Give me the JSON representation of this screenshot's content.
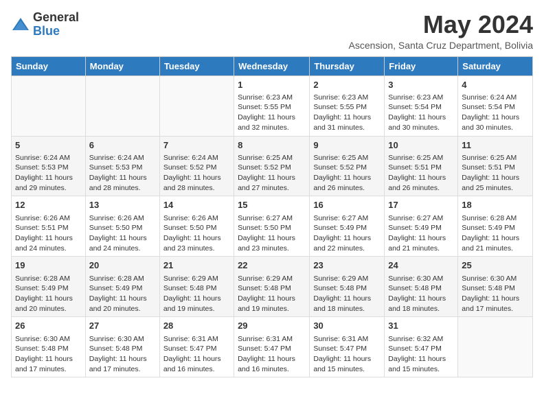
{
  "logo": {
    "general": "General",
    "blue": "Blue"
  },
  "title": "May 2024",
  "subtitle": "Ascension, Santa Cruz Department, Bolivia",
  "days_header": [
    "Sunday",
    "Monday",
    "Tuesday",
    "Wednesday",
    "Thursday",
    "Friday",
    "Saturday"
  ],
  "weeks": [
    [
      {
        "day": "",
        "text": ""
      },
      {
        "day": "",
        "text": ""
      },
      {
        "day": "",
        "text": ""
      },
      {
        "day": "1",
        "text": "Sunrise: 6:23 AM\nSunset: 5:55 PM\nDaylight: 11 hours and 32 minutes."
      },
      {
        "day": "2",
        "text": "Sunrise: 6:23 AM\nSunset: 5:55 PM\nDaylight: 11 hours and 31 minutes."
      },
      {
        "day": "3",
        "text": "Sunrise: 6:23 AM\nSunset: 5:54 PM\nDaylight: 11 hours and 30 minutes."
      },
      {
        "day": "4",
        "text": "Sunrise: 6:24 AM\nSunset: 5:54 PM\nDaylight: 11 hours and 30 minutes."
      }
    ],
    [
      {
        "day": "5",
        "text": "Sunrise: 6:24 AM\nSunset: 5:53 PM\nDaylight: 11 hours and 29 minutes."
      },
      {
        "day": "6",
        "text": "Sunrise: 6:24 AM\nSunset: 5:53 PM\nDaylight: 11 hours and 28 minutes."
      },
      {
        "day": "7",
        "text": "Sunrise: 6:24 AM\nSunset: 5:52 PM\nDaylight: 11 hours and 28 minutes."
      },
      {
        "day": "8",
        "text": "Sunrise: 6:25 AM\nSunset: 5:52 PM\nDaylight: 11 hours and 27 minutes."
      },
      {
        "day": "9",
        "text": "Sunrise: 6:25 AM\nSunset: 5:52 PM\nDaylight: 11 hours and 26 minutes."
      },
      {
        "day": "10",
        "text": "Sunrise: 6:25 AM\nSunset: 5:51 PM\nDaylight: 11 hours and 26 minutes."
      },
      {
        "day": "11",
        "text": "Sunrise: 6:25 AM\nSunset: 5:51 PM\nDaylight: 11 hours and 25 minutes."
      }
    ],
    [
      {
        "day": "12",
        "text": "Sunrise: 6:26 AM\nSunset: 5:51 PM\nDaylight: 11 hours and 24 minutes."
      },
      {
        "day": "13",
        "text": "Sunrise: 6:26 AM\nSunset: 5:50 PM\nDaylight: 11 hours and 24 minutes."
      },
      {
        "day": "14",
        "text": "Sunrise: 6:26 AM\nSunset: 5:50 PM\nDaylight: 11 hours and 23 minutes."
      },
      {
        "day": "15",
        "text": "Sunrise: 6:27 AM\nSunset: 5:50 PM\nDaylight: 11 hours and 23 minutes."
      },
      {
        "day": "16",
        "text": "Sunrise: 6:27 AM\nSunset: 5:49 PM\nDaylight: 11 hours and 22 minutes."
      },
      {
        "day": "17",
        "text": "Sunrise: 6:27 AM\nSunset: 5:49 PM\nDaylight: 11 hours and 21 minutes."
      },
      {
        "day": "18",
        "text": "Sunrise: 6:28 AM\nSunset: 5:49 PM\nDaylight: 11 hours and 21 minutes."
      }
    ],
    [
      {
        "day": "19",
        "text": "Sunrise: 6:28 AM\nSunset: 5:49 PM\nDaylight: 11 hours and 20 minutes."
      },
      {
        "day": "20",
        "text": "Sunrise: 6:28 AM\nSunset: 5:49 PM\nDaylight: 11 hours and 20 minutes."
      },
      {
        "day": "21",
        "text": "Sunrise: 6:29 AM\nSunset: 5:48 PM\nDaylight: 11 hours and 19 minutes."
      },
      {
        "day": "22",
        "text": "Sunrise: 6:29 AM\nSunset: 5:48 PM\nDaylight: 11 hours and 19 minutes."
      },
      {
        "day": "23",
        "text": "Sunrise: 6:29 AM\nSunset: 5:48 PM\nDaylight: 11 hours and 18 minutes."
      },
      {
        "day": "24",
        "text": "Sunrise: 6:30 AM\nSunset: 5:48 PM\nDaylight: 11 hours and 18 minutes."
      },
      {
        "day": "25",
        "text": "Sunrise: 6:30 AM\nSunset: 5:48 PM\nDaylight: 11 hours and 17 minutes."
      }
    ],
    [
      {
        "day": "26",
        "text": "Sunrise: 6:30 AM\nSunset: 5:48 PM\nDaylight: 11 hours and 17 minutes."
      },
      {
        "day": "27",
        "text": "Sunrise: 6:30 AM\nSunset: 5:48 PM\nDaylight: 11 hours and 17 minutes."
      },
      {
        "day": "28",
        "text": "Sunrise: 6:31 AM\nSunset: 5:47 PM\nDaylight: 11 hours and 16 minutes."
      },
      {
        "day": "29",
        "text": "Sunrise: 6:31 AM\nSunset: 5:47 PM\nDaylight: 11 hours and 16 minutes."
      },
      {
        "day": "30",
        "text": "Sunrise: 6:31 AM\nSunset: 5:47 PM\nDaylight: 11 hours and 15 minutes."
      },
      {
        "day": "31",
        "text": "Sunrise: 6:32 AM\nSunset: 5:47 PM\nDaylight: 11 hours and 15 minutes."
      },
      {
        "day": "",
        "text": ""
      }
    ]
  ]
}
